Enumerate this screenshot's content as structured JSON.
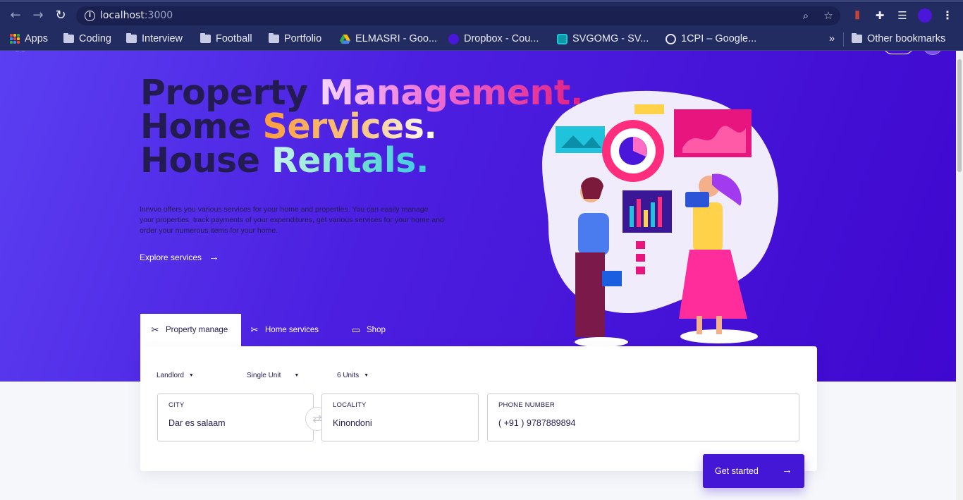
{
  "browser": {
    "url_host": "localhost",
    "url_port": ":3000",
    "bookmarks": [
      {
        "label": "Apps",
        "type": "apps"
      },
      {
        "label": "Coding",
        "type": "folder"
      },
      {
        "label": "Interview",
        "type": "folder"
      },
      {
        "label": "Football",
        "type": "folder"
      },
      {
        "label": "Portfolio",
        "type": "folder"
      },
      {
        "label": "ELMASRI - Goo...",
        "type": "favicon",
        "icon": "google-drive-icon"
      },
      {
        "label": "Dropbox - Cou...",
        "type": "favicon",
        "icon": "dropbox-icon"
      },
      {
        "label": "SVGOMG - SV...",
        "type": "favicon",
        "icon": "svgomg-icon"
      },
      {
        "label": "1CPI – Google...",
        "type": "favicon",
        "icon": "globe-icon"
      }
    ],
    "overflow_label": "»",
    "other_bookmarks": "Other bookmarks"
  },
  "hero": {
    "line1": {
      "dark": "Property",
      "accent": "Management."
    },
    "line2": {
      "dark": "Home",
      "accent": "Services."
    },
    "line3": {
      "dark": "House",
      "accent": "Rentals."
    },
    "description": "Innvvo offers you various services for your home and properties. You can easily manage your properties, track payments of your expenditures, get various services for your home and order your numerous items for your home.",
    "explore_label": "Explore services",
    "arrow": "→"
  },
  "tabs": [
    {
      "label": "Property manage",
      "icon": "tools-icon",
      "active": true
    },
    {
      "label": "Home services",
      "icon": "tools-icon",
      "active": false
    },
    {
      "label": "Shop",
      "icon": "shop-icon",
      "active": false
    }
  ],
  "form": {
    "dropdowns": [
      {
        "value": "Landlord"
      },
      {
        "value": "Single Unit"
      },
      {
        "value": "6 Units"
      }
    ],
    "city": {
      "label": "CITY",
      "value": "Dar es salaam"
    },
    "locality": {
      "label": "LOCALITY",
      "value": "Kinondoni"
    },
    "phone": {
      "label": "PHONE NUMBER",
      "value": "( +91 ) 9787889894"
    },
    "cta_label": "Get started"
  },
  "colors": {
    "hero_gradient_start": "#5b3ff2",
    "hero_gradient_end": "#3f07cf",
    "cta": "#4416d6",
    "text_dark": "#241b53"
  }
}
